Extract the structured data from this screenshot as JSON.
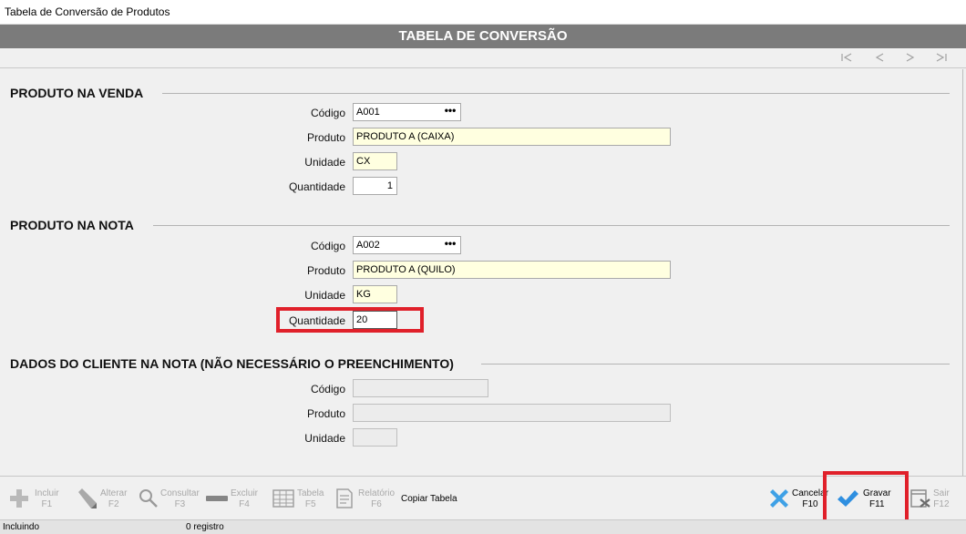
{
  "window": {
    "title": "Tabela de Conversão de Produtos"
  },
  "form": {
    "title": "TABELA DE CONVERSÃO"
  },
  "nav": {
    "first": "first-record",
    "prev": "previous-record",
    "next": "next-record",
    "last": "last-record"
  },
  "venda": {
    "title": "PRODUTO NA VENDA",
    "codigo_label": "Código",
    "codigo": "A001",
    "produto_label": "Produto",
    "produto": "PRODUTO A (CAIXA)",
    "unidade_label": "Unidade",
    "unidade": "CX",
    "quantidade_label": "Quantidade",
    "quantidade": "1"
  },
  "nota": {
    "title": "PRODUTO NA NOTA",
    "codigo_label": "Código",
    "codigo": "A002",
    "produto_label": "Produto",
    "produto": "PRODUTO A (QUILO)",
    "unidade_label": "Unidade",
    "unidade": "KG",
    "quantidade_label": "Quantidade",
    "quantidade": "20"
  },
  "cliente": {
    "title": "DADOS DO CLIENTE NA NOTA (NÃO NECESSÁRIO O PREENCHIMENTO)",
    "codigo_label": "Código",
    "codigo": "",
    "produto_label": "Produto",
    "produto": "",
    "unidade_label": "Unidade",
    "unidade": ""
  },
  "lookup_glyph": "•••",
  "toolbar": {
    "incluir": "Incluir",
    "incluir_key": "F1",
    "alterar": "Alterar",
    "alterar_key": "F2",
    "consultar": "Consultar",
    "consultar_key": "F3",
    "excluir": "Excluir",
    "excluir_key": "F4",
    "tabela": "Tabela",
    "tabela_key": "F5",
    "relatorio": "Relatório",
    "relatorio_key": "F6",
    "copiar": "Copiar Tabela",
    "cancelar": "Cancelar",
    "cancelar_key": "F10",
    "gravar": "Gravar",
    "gravar_key": "F11",
    "sair": "Sair",
    "sair_key": "F12"
  },
  "status": {
    "mode": "Incluindo",
    "records": "0 registro"
  },
  "colors": {
    "header": "#7b7b7b",
    "highlight": "#e0202a",
    "accent": "#2f8fe0",
    "field_yellow": "#ffffe0"
  }
}
